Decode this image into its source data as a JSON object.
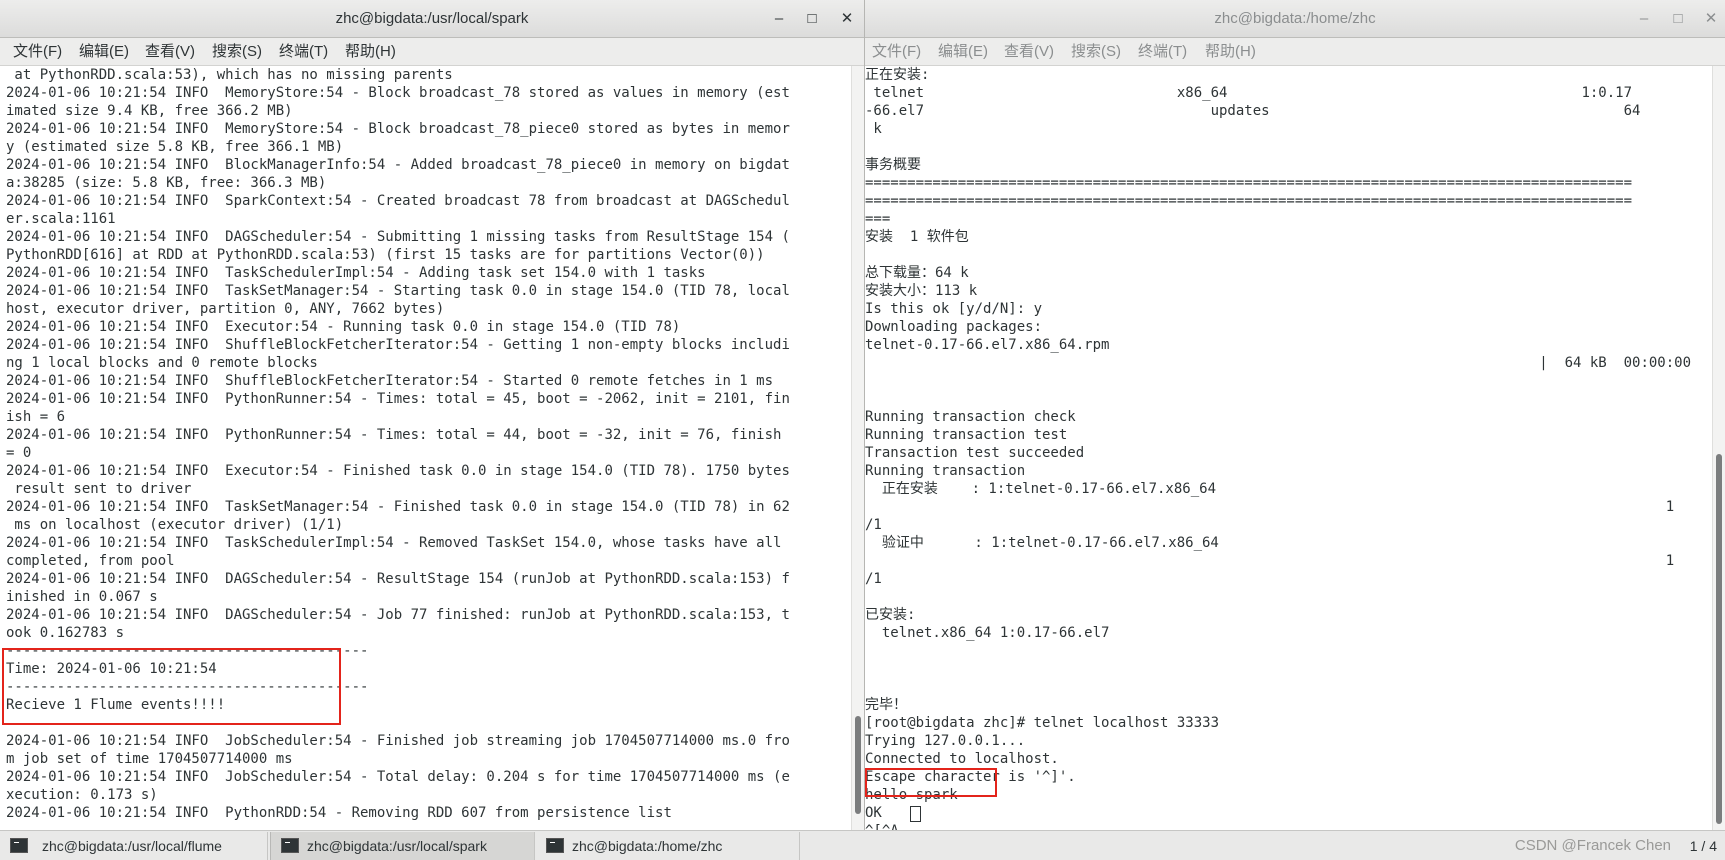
{
  "left_window": {
    "title": "zhc@bigdata:/usr/local/spark",
    "menu": [
      "文件(F)",
      "编辑(E)",
      "查看(V)",
      "搜索(S)",
      "终端(T)",
      "帮助(H)"
    ],
    "lines": [
      " at PythonRDD.scala:53), which has no missing parents",
      "2024-01-06 10:21:54 INFO  MemoryStore:54 - Block broadcast_78 stored as values in memory (est",
      "imated size 9.4 KB, free 366.2 MB)",
      "2024-01-06 10:21:54 INFO  MemoryStore:54 - Block broadcast_78_piece0 stored as bytes in memor",
      "y (estimated size 5.8 KB, free 366.1 MB)",
      "2024-01-06 10:21:54 INFO  BlockManagerInfo:54 - Added broadcast_78_piece0 in memory on bigdat",
      "a:38285 (size: 5.8 KB, free: 366.3 MB)",
      "2024-01-06 10:21:54 INFO  SparkContext:54 - Created broadcast 78 from broadcast at DAGSchedul",
      "er.scala:1161",
      "2024-01-06 10:21:54 INFO  DAGScheduler:54 - Submitting 1 missing tasks from ResultStage 154 (",
      "PythonRDD[616] at RDD at PythonRDD.scala:53) (first 15 tasks are for partitions Vector(0))",
      "2024-01-06 10:21:54 INFO  TaskSchedulerImpl:54 - Adding task set 154.0 with 1 tasks",
      "2024-01-06 10:21:54 INFO  TaskSetManager:54 - Starting task 0.0 in stage 154.0 (TID 78, local",
      "host, executor driver, partition 0, ANY, 7662 bytes)",
      "2024-01-06 10:21:54 INFO  Executor:54 - Running task 0.0 in stage 154.0 (TID 78)",
      "2024-01-06 10:21:54 INFO  ShuffleBlockFetcherIterator:54 - Getting 1 non-empty blocks includi",
      "ng 1 local blocks and 0 remote blocks",
      "2024-01-06 10:21:54 INFO  ShuffleBlockFetcherIterator:54 - Started 0 remote fetches in 1 ms",
      "2024-01-06 10:21:54 INFO  PythonRunner:54 - Times: total = 45, boot = -2062, init = 2101, fin",
      "ish = 6",
      "2024-01-06 10:21:54 INFO  PythonRunner:54 - Times: total = 44, boot = -32, init = 76, finish",
      "= 0",
      "2024-01-06 10:21:54 INFO  Executor:54 - Finished task 0.0 in stage 154.0 (TID 78). 1750 bytes",
      " result sent to driver",
      "2024-01-06 10:21:54 INFO  TaskSetManager:54 - Finished task 0.0 in stage 154.0 (TID 78) in 62",
      " ms on localhost (executor driver) (1/1)",
      "2024-01-06 10:21:54 INFO  TaskSchedulerImpl:54 - Removed TaskSet 154.0, whose tasks have all",
      "completed, from pool",
      "2024-01-06 10:21:54 INFO  DAGScheduler:54 - ResultStage 154 (runJob at PythonRDD.scala:153) f",
      "inished in 0.067 s",
      "2024-01-06 10:21:54 INFO  DAGScheduler:54 - Job 77 finished: runJob at PythonRDD.scala:153, t",
      "ook 0.162783 s",
      "-------------------------------------------",
      "Time: 2024-01-06 10:21:54",
      "-------------------------------------------",
      "Recieve 1 Flume events!!!!",
      "",
      "2024-01-06 10:21:54 INFO  JobScheduler:54 - Finished job streaming job 1704507714000 ms.0 fro",
      "m job set of time 1704507714000 ms",
      "2024-01-06 10:21:54 INFO  JobScheduler:54 - Total delay: 0.204 s for time 1704507714000 ms (e",
      "xecution: 0.173 s)",
      "2024-01-06 10:21:54 INFO  PythonRDD:54 - Removing RDD 607 from persistence list"
    ]
  },
  "right_window": {
    "title": "zhc@bigdata:/home/zhc",
    "menu": [
      "文件(F)",
      "编辑(E)",
      "查看(V)",
      "搜索(S)",
      "终端(T)",
      "帮助(H)"
    ],
    "lines": [
      "正在安装:",
      " telnet                              x86_64                                          1:0.17",
      "-66.el7                                  updates                                          64",
      " k",
      "",
      "事务概要",
      "===========================================================================================",
      "===========================================================================================",
      "===",
      "安装  1 软件包",
      "",
      "总下载量：64 k",
      "安装大小：113 k",
      "Is this ok [y/d/N]: y",
      "Downloading packages:",
      "telnet-0.17-66.el7.x86_64.rpm",
      "                                                                                |  64 kB  00:00:00",
      "",
      "",
      "Running transaction check",
      "Running transaction test",
      "Transaction test succeeded",
      "Running transaction",
      "  正在安装    : 1:telnet-0.17-66.el7.x86_64",
      "                                                                                               1",
      "/1",
      "  验证中      : 1:telnet-0.17-66.el7.x86_64",
      "                                                                                               1",
      "/1",
      "",
      "已安装:",
      "  telnet.x86_64 1:0.17-66.el7",
      "",
      "",
      "",
      "完毕！",
      "[root@bigdata zhc]# telnet localhost 33333",
      "Trying 127.0.0.1...",
      "Connected to localhost.",
      "Escape character is '^]'.",
      "hello spark",
      "OK",
      "^[^A"
    ]
  },
  "taskbar": {
    "tasks": [
      {
        "label": "zhc@bigdata:/usr/local/flume"
      },
      {
        "label": "zhc@bigdata:/usr/local/spark"
      },
      {
        "label": "zhc@bigdata:/home/zhc"
      }
    ],
    "watermark": "CSDN @Francek Chen",
    "pager": "1 / 4"
  },
  "colors": {
    "highlight": "#e3241b",
    "terminal_text": "#2e3436",
    "terminal_background": "#ffffff"
  }
}
